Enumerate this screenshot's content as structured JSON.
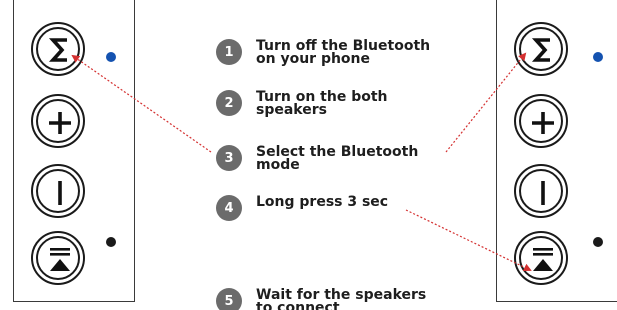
{
  "colors": {
    "dot_blue": "#1452b0",
    "dot_black": "#1a1a1a",
    "connector_red": "#d43030",
    "badge_gray": "#6b6b6b"
  },
  "buttons": [
    {
      "name": "mode-button",
      "icon": "sigma-icon"
    },
    {
      "name": "volume-up-button",
      "icon": "plus-icon"
    },
    {
      "name": "volume-down-button",
      "icon": "minus-icon"
    },
    {
      "name": "eject-button",
      "icon": "eject-icon"
    }
  ],
  "steps": [
    {
      "number": "1",
      "text": "Turn off the Bluetooth\non your phone"
    },
    {
      "number": "2",
      "text": "Turn on the both\nspeakers"
    },
    {
      "number": "3",
      "text": "Select the Bluetooth\nmode"
    },
    {
      "number": "4",
      "text": "Long press 3 sec"
    },
    {
      "number": "5",
      "text": "Wait for the speakers\nto connect"
    }
  ]
}
